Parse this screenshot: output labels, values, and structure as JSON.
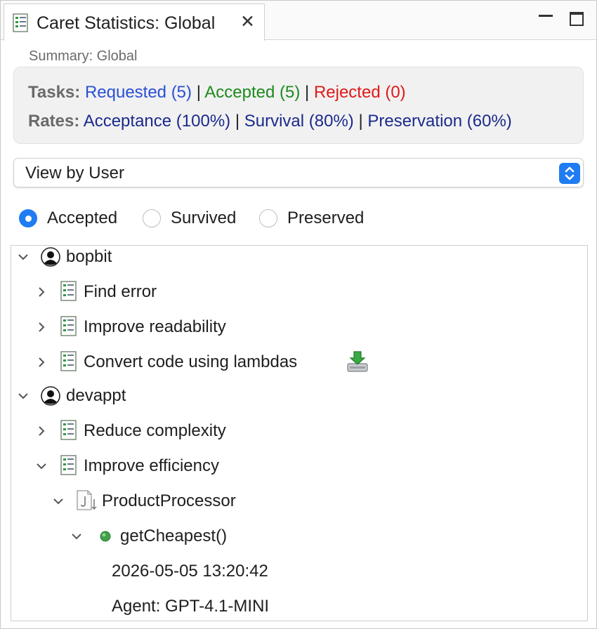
{
  "tab": {
    "title": "Caret Statistics: Global",
    "close": "✕"
  },
  "summary": {
    "label": "Summary: Global",
    "tasks_label": "Tasks:",
    "requested": "Requested (5)",
    "accepted": "Accepted (5)",
    "rejected": "Rejected (0)",
    "rates_label": "Rates:",
    "acceptance": "Acceptance (100%)",
    "survival": "Survival (80%)",
    "preservation": "Preservation (60%)",
    "separator": "|"
  },
  "view_select": {
    "value": "View by User"
  },
  "radios": [
    {
      "label": "Accepted",
      "selected": true
    },
    {
      "label": "Survived",
      "selected": false
    },
    {
      "label": "Preserved",
      "selected": false
    }
  ],
  "tree": {
    "users": [
      {
        "name": "bopbit",
        "expanded": true,
        "tasks": [
          {
            "label": "Find error",
            "expanded": false
          },
          {
            "label": "Improve readability",
            "expanded": false
          },
          {
            "label": "Convert code using lambdas",
            "expanded": false,
            "badge": "import-icon"
          }
        ]
      },
      {
        "name": "devappt",
        "expanded": true,
        "tasks": [
          {
            "label": "Reduce complexity",
            "expanded": false
          },
          {
            "label": "Improve efficiency",
            "expanded": true,
            "children": [
              {
                "label": "ProductProcessor",
                "expanded": true,
                "children": [
                  {
                    "label": "getCheapest()",
                    "expanded": true,
                    "details": [
                      "2026-05-05 13:20:42",
                      "Agent: GPT-4.1-MINI"
                    ]
                  }
                ]
              }
            ]
          }
        ]
      }
    ]
  },
  "colors": {
    "accent": "#1f7cf2",
    "requested": "#2a4fd6",
    "accepted": "#1d8a1d",
    "rejected": "#e01919",
    "rates": "#1b2a8c"
  }
}
